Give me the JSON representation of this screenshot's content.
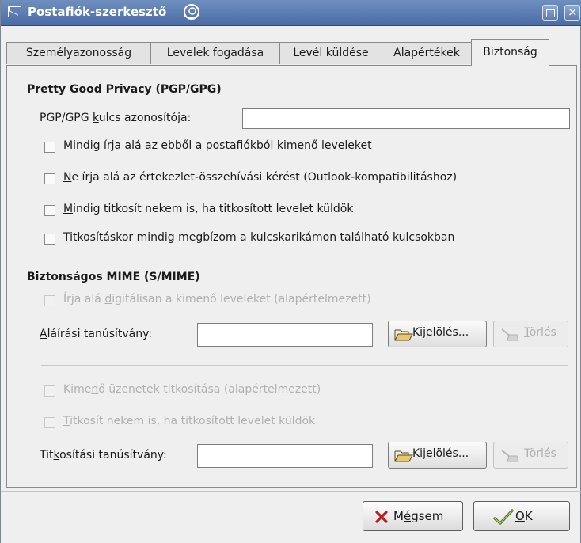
{
  "window": {
    "title": "Postafiók-szerkesztő"
  },
  "tabs": [
    {
      "label": "Személyazonosság"
    },
    {
      "label": "Levelek fogadása"
    },
    {
      "label": "Levél küldése"
    },
    {
      "label": "Alapértékek"
    },
    {
      "label": "Biztonság",
      "active": true
    }
  ],
  "pgp": {
    "heading": "Pretty Good Privacy (PGP/GPG)",
    "key_label_pre": "PGP/GPG ",
    "key_label_u": "k",
    "key_label_post": "ulcs azonosítója:",
    "key_value": "",
    "options": [
      {
        "pre": "M",
        "u": "i",
        "post": "ndig írja alá az ebből a postafiókból kimenő leveleket",
        "checked": false
      },
      {
        "pre": "",
        "u": "N",
        "post": "e írja alá az értekezlet-összehívási kérést (Outlook-kompatibilitáshoz)",
        "checked": false
      },
      {
        "pre": "",
        "u": "M",
        "post": "indig titkosít nekem is, ha titkosított levelet küldök",
        "checked": false
      },
      {
        "pre": "Titkosításkor mindig me",
        "u": "g",
        "post": "bízom a kulcskarikámon található kulcsokban",
        "checked": false
      }
    ]
  },
  "smime": {
    "heading": "Biztonságos MIME (S/MIME)",
    "sign_default": {
      "pre": "Írja alá ",
      "u": "d",
      "post": "igitálisan a kimenő leveleket (alapértelmezett)",
      "checked": false
    },
    "sign_cert_label_u": "A",
    "sign_cert_label_post": "láírási tanúsítvány:",
    "sign_cert_value": "",
    "select_pre": "Ki",
    "select_u": "j",
    "select_post": "elölés...",
    "delete_u": "T",
    "delete_post": "örlés",
    "encrypt_default": {
      "pre": "Kime",
      "u": "n",
      "post": "ő üzenetek titkosítása (alapértelmezett)",
      "checked": false
    },
    "encrypt_self": {
      "pre": "",
      "u": "T",
      "post": "itkosít nekem is, ha titkosított levelet küldök",
      "checked": false
    },
    "enc_cert_label_pre": "Tit",
    "enc_cert_label_u": "k",
    "enc_cert_label_post": "osítási tanúsítvány:",
    "enc_cert_value": ""
  },
  "footer": {
    "cancel_pre": "M",
    "cancel_u": "é",
    "cancel_post": "gsem",
    "ok_u": "O",
    "ok_post": "K"
  }
}
